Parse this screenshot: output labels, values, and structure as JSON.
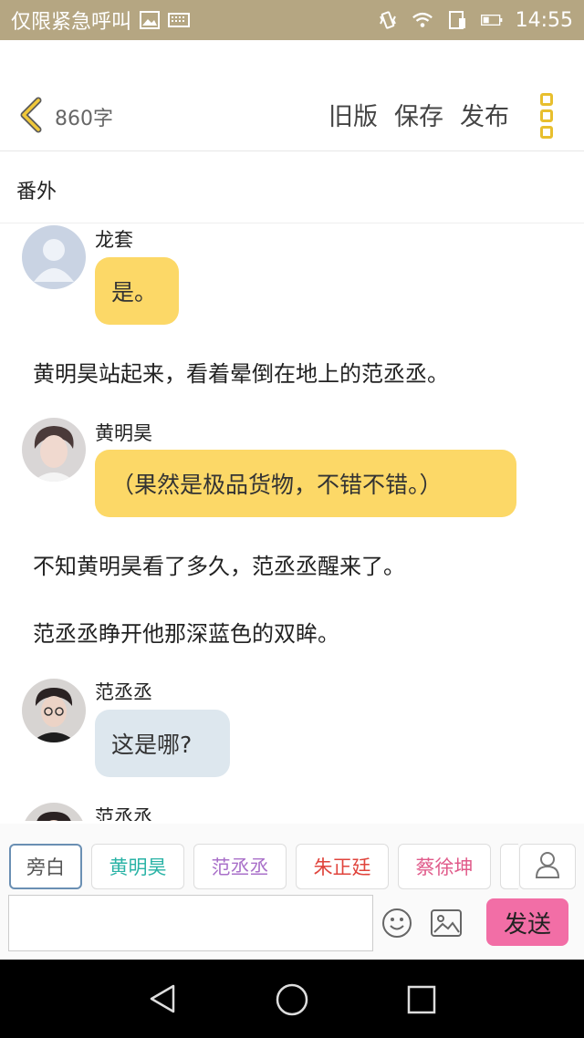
{
  "status": {
    "carrier": "仅限紧急呼叫",
    "time": "14:55"
  },
  "header": {
    "char_count": "860字",
    "actions": [
      "旧版",
      "保存",
      "发布"
    ]
  },
  "chapter_title": "番外",
  "messages": [
    {
      "type": "dialog",
      "sender": "龙套",
      "text": "是。",
      "bubble": "yellow",
      "avatar": "default-avatar"
    },
    {
      "type": "narration",
      "text": "黄明昊站起来，看着晕倒在地上的范丞丞。"
    },
    {
      "type": "dialog",
      "sender": "黄明昊",
      "text": "（果然是极品货物，不错不错。）",
      "bubble": "yellow",
      "avatar": "photo-avatar"
    },
    {
      "type": "narration",
      "text": "不知黄明昊看了多久，范丞丞醒来了。"
    },
    {
      "type": "narration",
      "text": "范丞丞睁开他那深蓝色的双眸。"
    },
    {
      "type": "dialog",
      "sender": "范丞丞",
      "text": "这是哪?",
      "bubble": "gray",
      "avatar": "photo-avatar"
    },
    {
      "type": "dialog",
      "sender": "范丞丞",
      "text": "",
      "bubble": "none",
      "avatar": "photo-avatar"
    }
  ],
  "roles": [
    {
      "label": "旁白",
      "color": "#555555",
      "selected": true
    },
    {
      "label": "黄明昊",
      "color": "#2ab3a6"
    },
    {
      "label": "范丞丞",
      "color": "#a970c9"
    },
    {
      "label": "朱正廷",
      "color": "#e0443c"
    },
    {
      "label": "蔡徐坤",
      "color": "#e05a8a"
    }
  ],
  "input": {
    "placeholder": ""
  },
  "send_label": "发送",
  "colors": {
    "accent": "#fcd867",
    "send": "#f26ea6",
    "status_bar": "#b5a682"
  }
}
